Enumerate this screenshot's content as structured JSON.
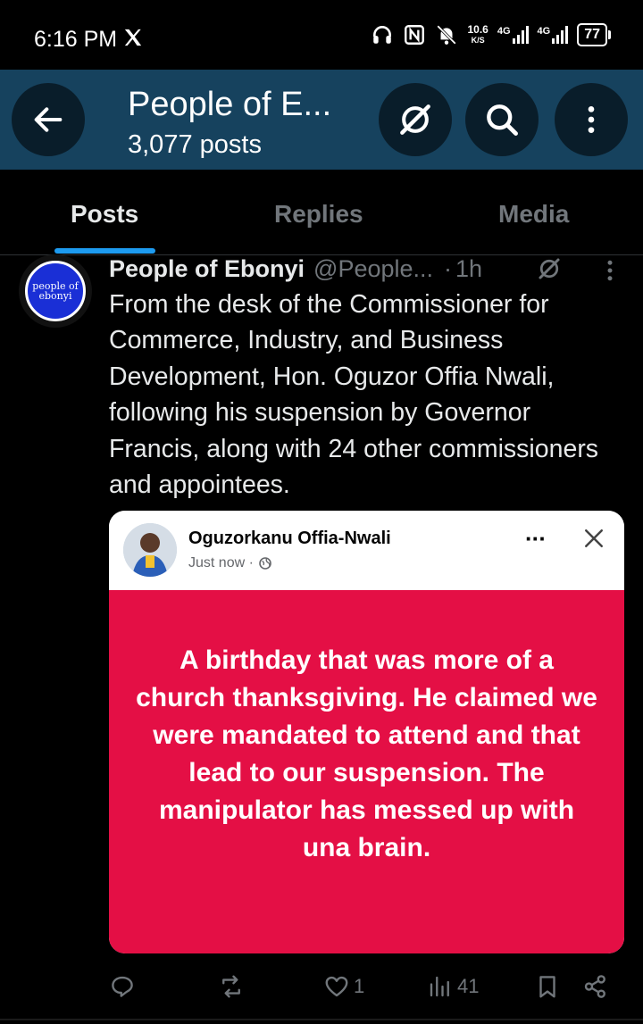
{
  "status_bar": {
    "time": "6:16 PM",
    "network_speed_value": "10.6",
    "network_speed_unit": "K/S",
    "signal_1": "4G",
    "signal_2": "4G",
    "battery": "77"
  },
  "header": {
    "title": "People of E...",
    "post_count": "3,077 posts"
  },
  "tabs": [
    {
      "label": "Posts",
      "active": true
    },
    {
      "label": "Replies",
      "active": false
    },
    {
      "label": "Media",
      "active": false
    }
  ],
  "post": {
    "avatar_text_line1": "people of",
    "avatar_text_line2": "ebonyi",
    "author": "People of Ebonyi",
    "handle": "@People...",
    "separator": "·",
    "time": "1h",
    "text": "From the desk of the Commissioner for Commerce, Industry, and Business Development, Hon. Oguzor Offia Nwali, following his suspension by Governor Francis, along with 24 other commissioners and appointees.",
    "embedded": {
      "name": "Oguzorkanu Offia-Nwali",
      "time": "Just now ·",
      "dots": "···",
      "body_text": "A birthday that was more of a church thanksgiving. He claimed we were mandated to attend and that lead to our suspension. The manipulator has messed up with una brain.",
      "body_color": "#e40f45"
    },
    "actions": {
      "replies": "",
      "reposts": "",
      "likes": "1",
      "views": "41"
    }
  },
  "colors": {
    "header_bg": "#16425e",
    "accent": "#1d9bf0",
    "muted": "#71767b"
  }
}
